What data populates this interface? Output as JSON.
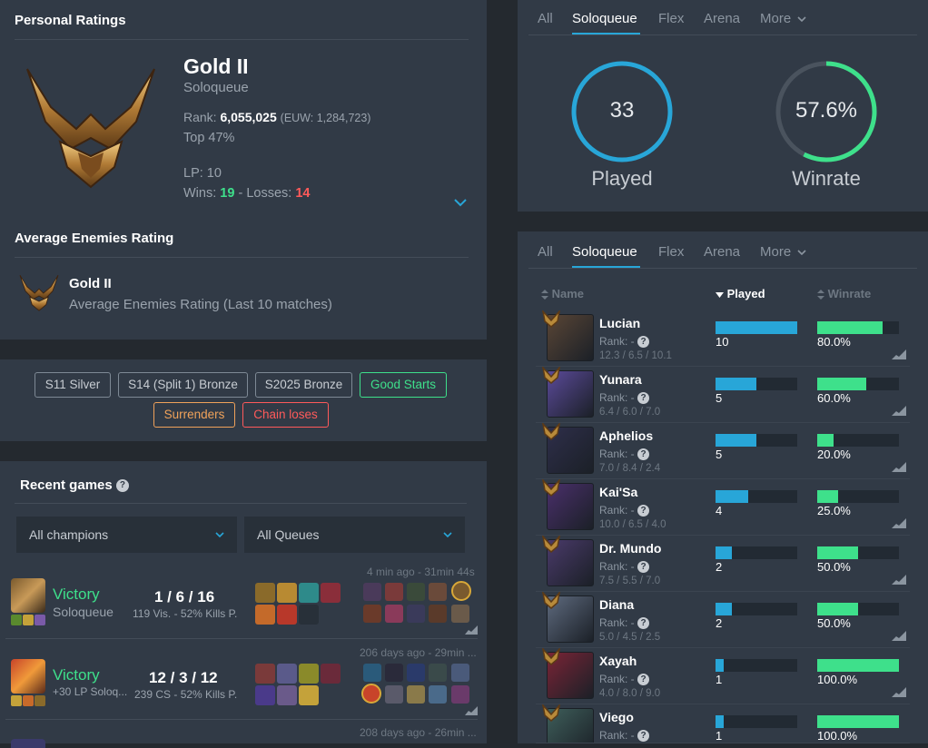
{
  "personal": {
    "title": "Personal Ratings",
    "tier": "Gold II",
    "queue": "Soloqueue",
    "rank_label": "Rank:",
    "rank_value": "6,055,025",
    "rank_region": "(EUW: 1,284,723)",
    "top": "Top 47%",
    "lp": "LP: 10",
    "wins_label": "Wins:",
    "wins": "19",
    "dash": "-",
    "losses_label": "Losses:",
    "losses": "14"
  },
  "enemies": {
    "title": "Average Enemies Rating",
    "tier": "Gold II",
    "desc": "Average Enemies Rating (Last 10 matches)"
  },
  "tags": [
    {
      "label": "S11 Silver"
    },
    {
      "label": "S14 (Split 1) Bronze"
    },
    {
      "label": "S2025 Bronze"
    },
    {
      "label": "Good Starts"
    },
    {
      "label": "Surrenders"
    },
    {
      "label": "Chain loses"
    }
  ],
  "recent": {
    "title": "Recent games",
    "champ_filter": "All champions",
    "queue_filter": "All Queues",
    "games": [
      {
        "result": "Victory",
        "queue": "Soloqueue",
        "kda": "1 / 6 / 16",
        "stats": "119 Vis. - 52% Kills P.",
        "time": "4 min ago - 31min 44s"
      },
      {
        "result": "Victory",
        "queue": "+30 LP Soloq...",
        "kda": "12 / 3 / 12",
        "stats": "239 CS - 52% Kills P.",
        "time": "206 days ago - 29min ..."
      },
      {
        "time": "208 days ago - 26min ..."
      }
    ]
  },
  "stats_tabs": {
    "tabs": [
      "All",
      "Soloqueue",
      "Flex",
      "Arena",
      "More"
    ],
    "played_value": "33",
    "played_label": "Played",
    "winrate_value": "57.6%",
    "winrate_label": "Winrate",
    "winrate_fraction": 0.576
  },
  "champ_tabs": {
    "tabs": [
      "All",
      "Soloqueue",
      "Flex",
      "Arena",
      "More"
    ],
    "col_name": "Name",
    "col_played": "Played",
    "col_winrate": "Winrate"
  },
  "champions": [
    {
      "name": "Lucian",
      "rank": "Rank: -",
      "kda": "12.3  /  6.5  /  10.1",
      "played": "10",
      "played_frac": 1.0,
      "winrate": "80.0%",
      "winrate_frac": 0.8,
      "color": "#5a4636"
    },
    {
      "name": "Yunara",
      "rank": "Rank: -",
      "kda": "6.4  /  6.0  /  7.0",
      "played": "5",
      "played_frac": 0.5,
      "winrate": "60.0%",
      "winrate_frac": 0.6,
      "color": "#5b4a9a"
    },
    {
      "name": "Aphelios",
      "rank": "Rank: -",
      "kda": "7.0  /  8.4  /  2.4",
      "played": "5",
      "played_frac": 0.5,
      "winrate": "20.0%",
      "winrate_frac": 0.2,
      "color": "#2e2e4a"
    },
    {
      "name": "Kai'Sa",
      "rank": "Rank: -",
      "kda": "10.0  /  6.5  /  4.0",
      "played": "4",
      "played_frac": 0.4,
      "winrate": "25.0%",
      "winrate_frac": 0.25,
      "color": "#4a2f6b"
    },
    {
      "name": "Dr. Mundo",
      "rank": "Rank: -",
      "kda": "7.5  /  5.5  /  7.0",
      "played": "2",
      "played_frac": 0.2,
      "winrate": "50.0%",
      "winrate_frac": 0.5,
      "color": "#4a3a6a"
    },
    {
      "name": "Diana",
      "rank": "Rank: -",
      "kda": "5.0  /  4.5  /  2.5",
      "played": "2",
      "played_frac": 0.2,
      "winrate": "50.0%",
      "winrate_frac": 0.5,
      "color": "#5e6a7e"
    },
    {
      "name": "Xayah",
      "rank": "Rank: -",
      "kda": "4.0  /  8.0  /  9.0",
      "played": "1",
      "played_frac": 0.1,
      "winrate": "100.0%",
      "winrate_frac": 1.0,
      "color": "#7a2436"
    },
    {
      "name": "Viego",
      "rank": "Rank: -",
      "kda": "",
      "played": "1",
      "played_frac": 0.1,
      "winrate": "100.0%",
      "winrate_frac": 1.0,
      "color": "#3e5e5a"
    }
  ],
  "colors": {
    "accent": "#28a6d8",
    "win": "#3ee08b",
    "loss": "#ff5a5a",
    "panel": "#313a46"
  }
}
